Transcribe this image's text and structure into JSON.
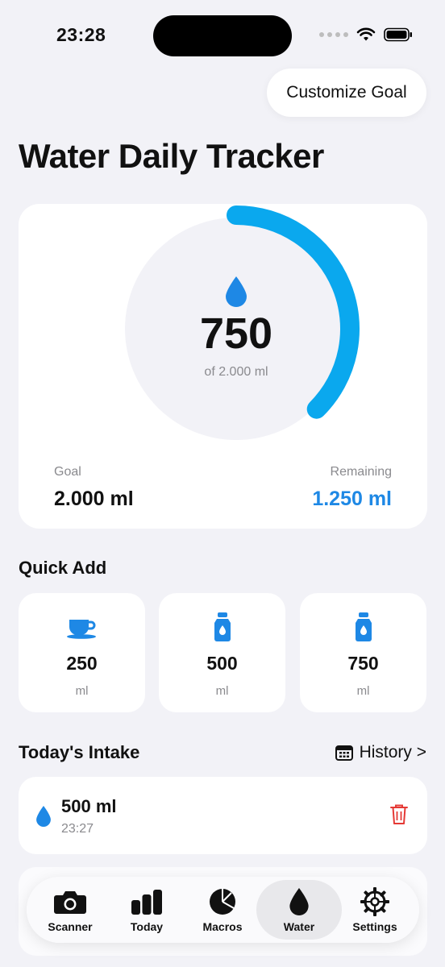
{
  "status_bar": {
    "time": "23:28"
  },
  "header": {
    "customize_label": "Customize Goal",
    "title": "Water Daily Tracker"
  },
  "progress": {
    "current": "750",
    "of_text": "of 2.000 ml",
    "fraction": 0.375,
    "goal_label": "Goal",
    "goal_value": "2.000 ml",
    "remaining_label": "Remaining",
    "remaining_value": "1.250 ml"
  },
  "quick_add": {
    "title": "Quick Add",
    "items": [
      {
        "amount": "250",
        "unit": "ml",
        "icon": "cup-icon"
      },
      {
        "amount": "500",
        "unit": "ml",
        "icon": "bottle-icon"
      },
      {
        "amount": "750",
        "unit": "ml",
        "icon": "bottle-icon"
      }
    ]
  },
  "intake": {
    "title": "Today's Intake",
    "history_label": "History >",
    "entries": [
      {
        "amount": "500 ml",
        "time": "23:27"
      }
    ]
  },
  "tab_bar": {
    "tabs": [
      {
        "label": "Scanner",
        "icon": "camera-icon"
      },
      {
        "label": "Today",
        "icon": "bar-chart-icon"
      },
      {
        "label": "Macros",
        "icon": "pie-chart-icon"
      },
      {
        "label": "Water",
        "icon": "water-drop-icon",
        "active": true
      },
      {
        "label": "Settings",
        "icon": "gear-icon"
      }
    ]
  },
  "colors": {
    "accent": "#1e88e5",
    "ring": "#0aa8ee",
    "trash": "#e53935"
  }
}
